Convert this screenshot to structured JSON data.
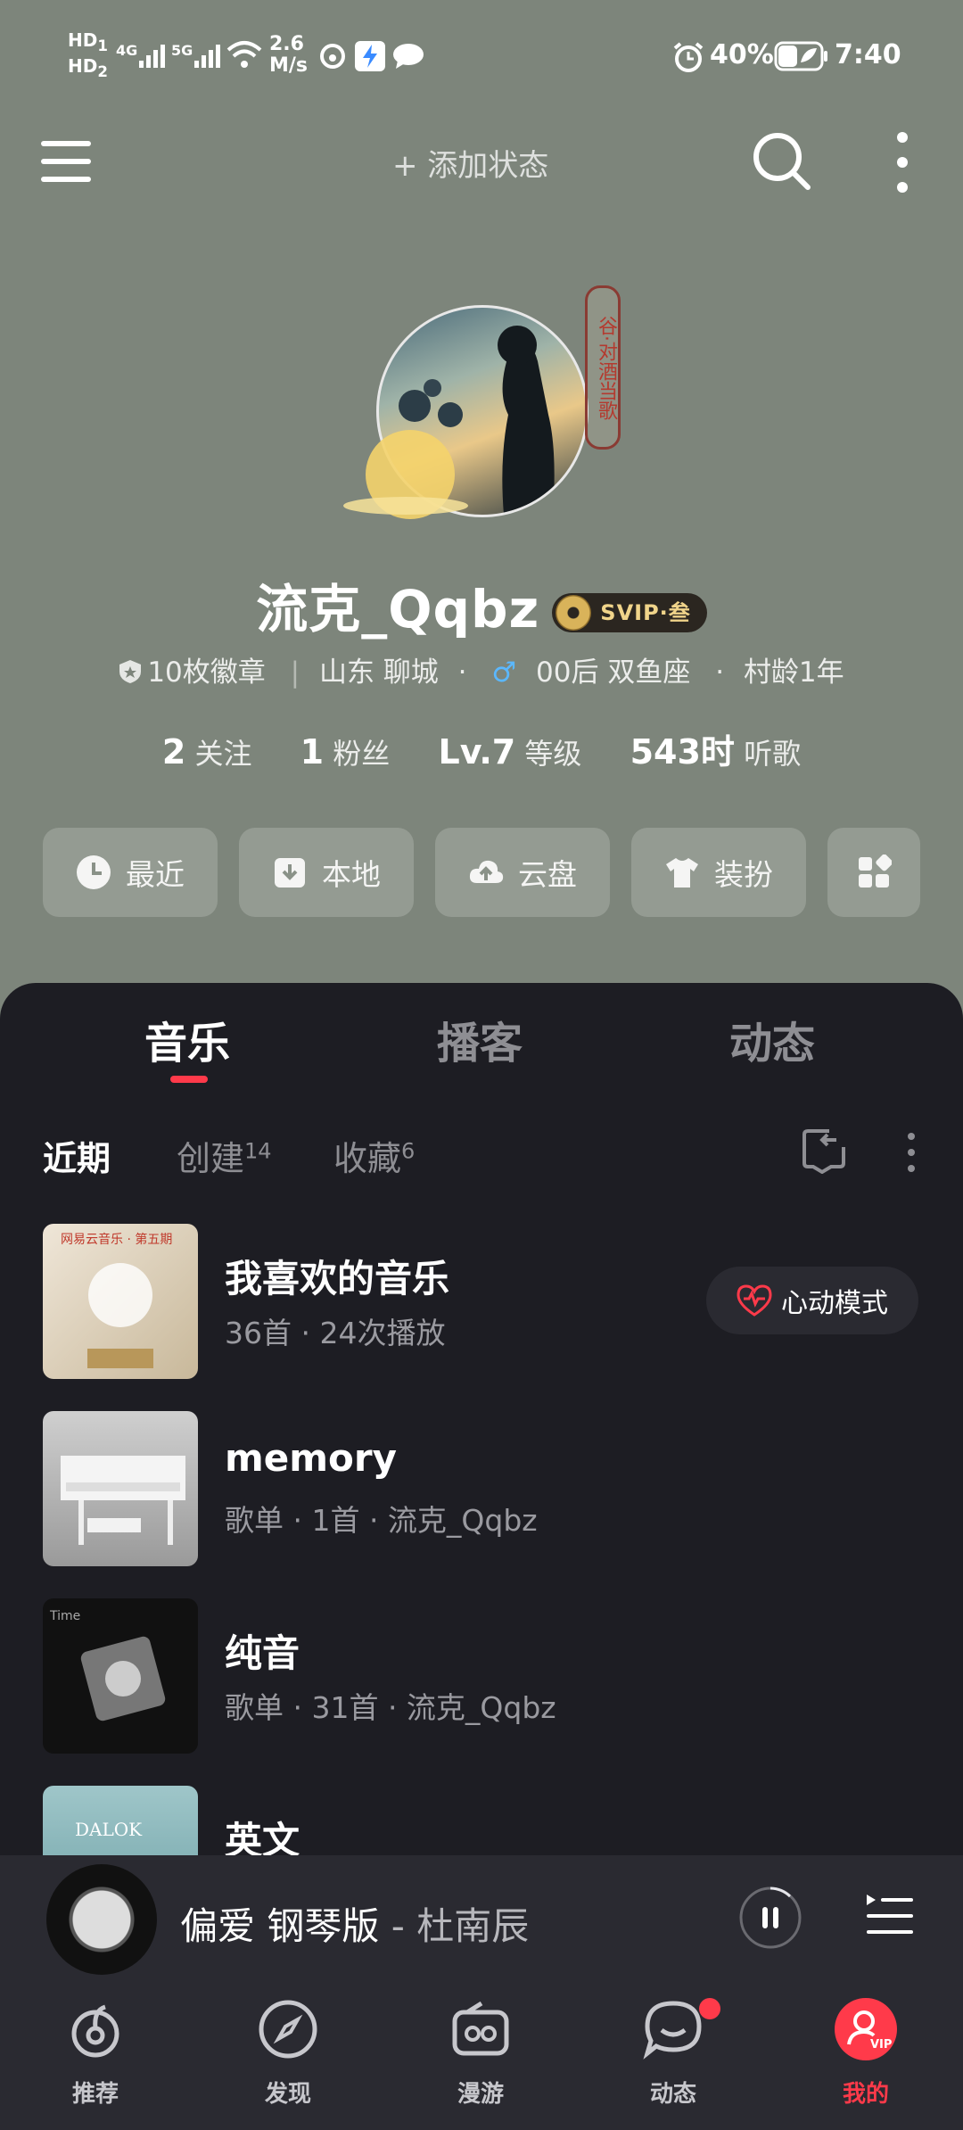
{
  "status": {
    "network_speed": "2.6\nM/s",
    "battery": "40%",
    "time": "7:40"
  },
  "topbar": {
    "add_status": "+ 添加状态"
  },
  "profile": {
    "username": "流克_Qqbz",
    "svip_label": "SVIP·叁",
    "badge_tag": "谷·对酒当歌",
    "badges": "10枚徽章",
    "location": "山东 聊城",
    "age_sign": "00后 双鱼座",
    "village_age": "村龄1年",
    "stats": [
      {
        "value": "2",
        "label": "关注"
      },
      {
        "value": "1",
        "label": "粉丝"
      },
      {
        "value": "Lv.7",
        "label": "等级"
      },
      {
        "value": "543时",
        "label": "听歌"
      }
    ]
  },
  "quick_buttons": [
    {
      "label": "最近",
      "icon": "clock-icon"
    },
    {
      "label": "本地",
      "icon": "download-box-icon"
    },
    {
      "label": "云盘",
      "icon": "cloud-upload-icon"
    },
    {
      "label": "装扮",
      "icon": "shirt-icon"
    },
    {
      "label": "",
      "icon": "grid-icon"
    }
  ],
  "tabs": [
    "音乐",
    "播客",
    "动态"
  ],
  "subtabs": [
    {
      "label": "近期",
      "count": ""
    },
    {
      "label": "创建",
      "count": "14"
    },
    {
      "label": "收藏",
      "count": "6"
    }
  ],
  "playlists": [
    {
      "title": "我喜欢的音乐",
      "subtitle": "36首 · 24次播放",
      "cover_text": "网易云音乐 · 第五期"
    },
    {
      "title": "memory",
      "subtitle": "歌单 · 1首 · 流克_Qqbz",
      "cover_text": ""
    },
    {
      "title": "纯音",
      "subtitle": "歌单 · 31首 · 流克_Qqbz",
      "cover_text": "Time"
    },
    {
      "title": "英文",
      "subtitle": "",
      "cover_text": "DALOK"
    }
  ],
  "heart_mode": "心动模式",
  "player": {
    "title": "偏爱 钢琴版",
    "artist": " - 杜南辰"
  },
  "nav": [
    {
      "label": "推荐",
      "icon": "netease-logo-icon"
    },
    {
      "label": "发现",
      "icon": "compass-icon"
    },
    {
      "label": "漫游",
      "icon": "radio-icon"
    },
    {
      "label": "动态",
      "icon": "chat-bubble-icon"
    },
    {
      "label": "我的",
      "icon": "profile-vip-icon"
    }
  ],
  "colors": {
    "accent": "#ff3a4a",
    "panel": "#1d1d23",
    "header_bg": "#7d857b"
  }
}
